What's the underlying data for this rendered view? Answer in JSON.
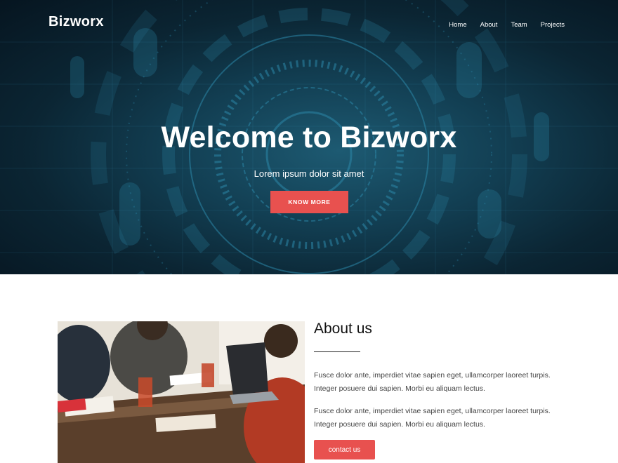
{
  "brand": "Bizworx",
  "nav": {
    "items": [
      "Home",
      "About",
      "Team",
      "Projects"
    ]
  },
  "hero": {
    "title": "Welcome to Bizworx",
    "subtitle": "Lorem ipsum dolor sit amet",
    "button_label": "KNOW MORE"
  },
  "about": {
    "title": "About us",
    "paragraphs": [
      "Fusce dolor ante, imperdiet vitae sapien eget, ullamcorper laoreet turpis. Integer posuere dui sapien. Morbi eu aliquam lectus.",
      "Fusce dolor ante, imperdiet vitae sapien eget, ullamcorper laoreet turpis. Integer posuere dui sapien. Morbi eu aliquam lectus."
    ],
    "button_label": "contact us"
  },
  "colors": {
    "accent": "#e8514f",
    "hero_dark": "#0b2533",
    "hero_glow": "#1d5a72"
  }
}
